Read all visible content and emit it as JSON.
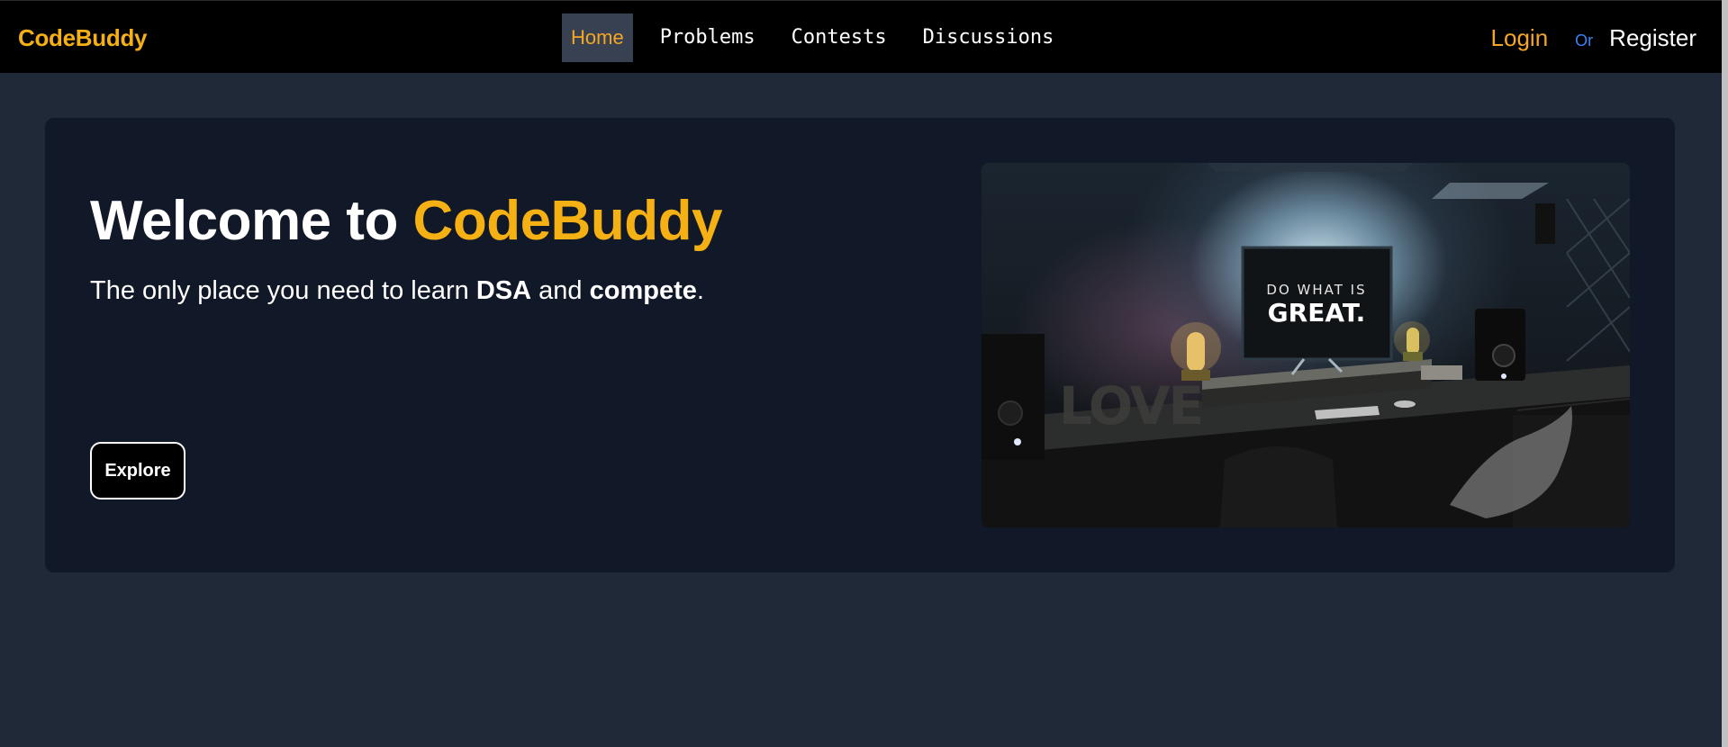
{
  "navbar": {
    "brand": "CodeBuddy",
    "links": [
      {
        "label": "Home",
        "active": true
      },
      {
        "label": "Problems",
        "active": false
      },
      {
        "label": "Contests",
        "active": false
      },
      {
        "label": "Discussions",
        "active": false
      }
    ],
    "login_label": "Login",
    "or_label": "Or",
    "register_label": "Register"
  },
  "hero": {
    "title_prefix": "Welcome to",
    "title_brand": "CodeBuddy",
    "subtitle_start": "The only place you need to learn",
    "subtitle_dsa": "DSA",
    "subtitle_and": "and",
    "subtitle_compete": "compete",
    "subtitle_end": ".",
    "explore_label": "Explore",
    "image": {
      "monitor_line1": "DO WHAT IS",
      "monitor_line2": "GREAT.",
      "letters": "LOVE"
    }
  },
  "colors": {
    "accent": "#f5b014",
    "page_bg": "#1f2937",
    "card_bg": "#111827",
    "nav_bg": "#000000",
    "active_tab_bg": "#374151",
    "or_blue": "#3b82f6"
  }
}
